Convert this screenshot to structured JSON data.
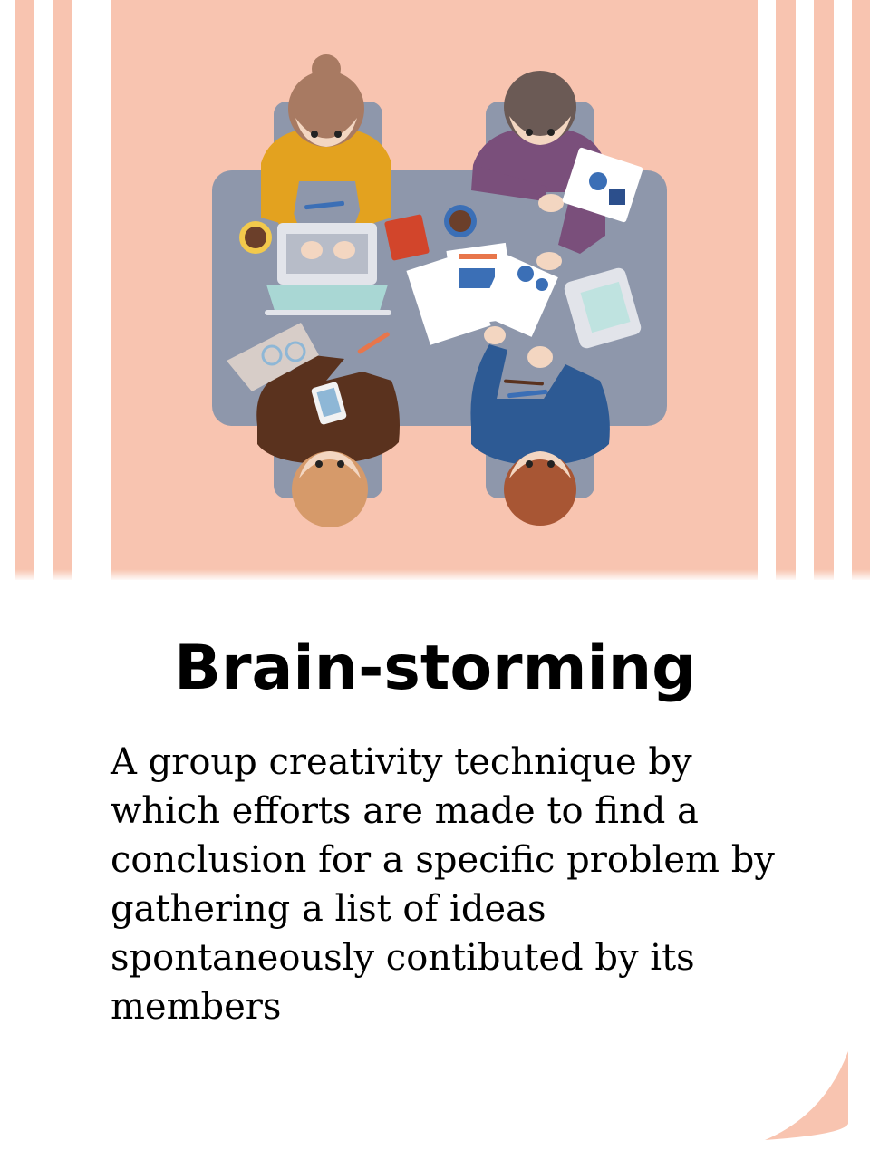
{
  "slide": {
    "title": "Brain-storming",
    "description": "A group creativity technique by which efforts are made to find a conclusion for a specific problem by gathering a list of ideas spontaneously contibuted by its members"
  },
  "colors": {
    "background_peach": "#f8c4b0",
    "stripe": "#ffffff",
    "table": "#8e97ab",
    "text": "#000000"
  },
  "illustration": {
    "subject": "four people at a meeting table viewed from above",
    "people": [
      "person-yellow-sweater",
      "person-purple-sweater",
      "person-brown-sweater",
      "person-blue-sweater"
    ]
  }
}
